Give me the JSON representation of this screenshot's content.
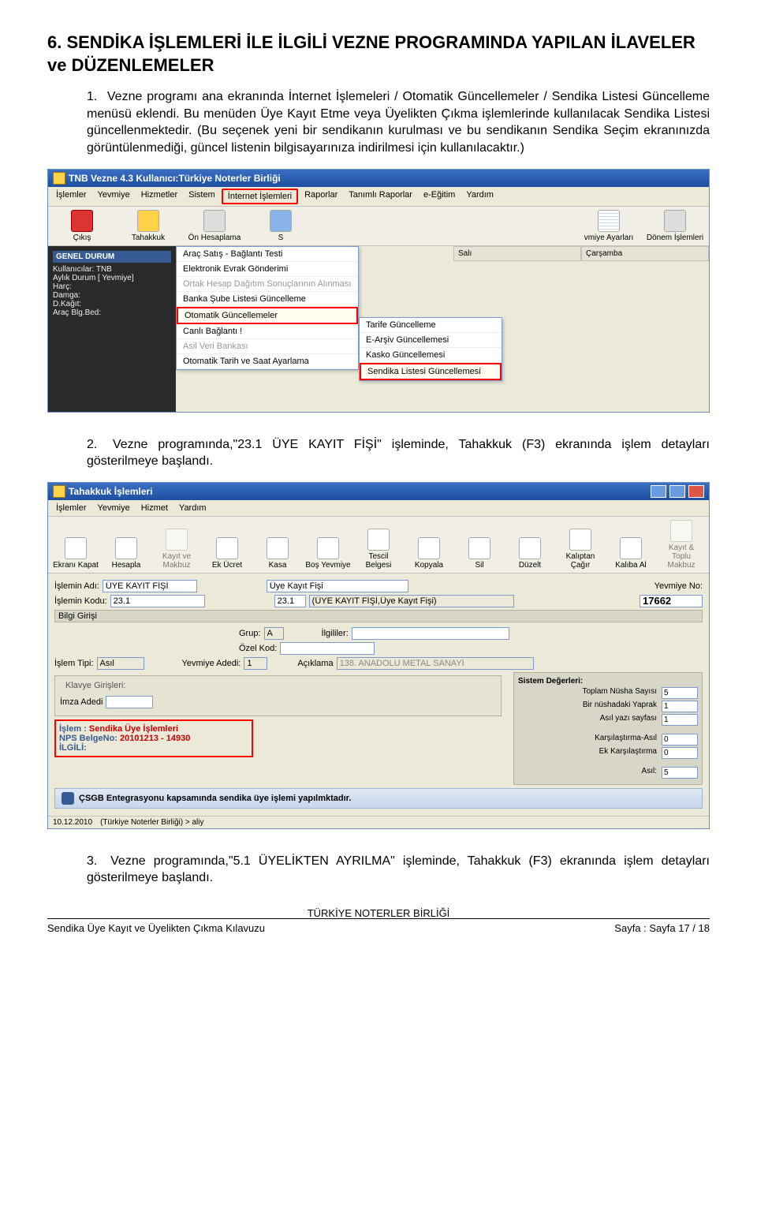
{
  "heading": "6. SENDİKA İŞLEMLERİ İLE İLGİLİ VEZNE PROGRAMINDA YAPILAN  İLAVELER ve DÜZENLEMELER",
  "para1_idx": "1.",
  "para1": "Vezne programı ana ekranında İnternet İşlemeleri / Otomatik Güncellemeler / Sendika Listesi Güncelleme menüsü eklendi. Bu menüden  Üye Kayıt Etme veya Üyelikten Çıkma işlemlerinde kullanılacak Sendika Listesi güncellenmektedir. (Bu seçenek yeni bir sendikanın kurulması ve bu sendikanın Sendika Seçim ekranınızda görüntülenmediği, güncel listenin bilgisayarınıza indirilmesi için kullanılacaktır.)",
  "para2_idx": "2.",
  "para2": "Vezne programında,\"23.1 ÜYE KAYIT FİŞİ\" işleminde, Tahakkuk (F3) ekranında işlem detayları gösterilmeye başlandı.",
  "para3_idx": "3.",
  "para3": "Vezne programında,\"5.1 ÜYELİKTEN AYRILMA\" işleminde, Tahakkuk (F3) ekranında işlem detayları gösterilmeye başlandı.",
  "shot1": {
    "title": "TNB Vezne 4.3  Kullanıcı:Türkiye Noterler Birliği",
    "menu": [
      "İşlemler",
      "Yevmiye",
      "Hizmetler",
      "Sistem",
      "İnternet İşlemleri",
      "Raporlar",
      "Tanımlı Raporlar",
      "e-Eğitim",
      "Yardım"
    ],
    "menu_hl_index": 4,
    "toolbar": [
      {
        "lbl": "Çıkış",
        "cls": "red"
      },
      {
        "lbl": "Tahakkuk",
        "cls": "yell"
      },
      {
        "lbl": "Ön Hesaplama",
        "cls": "gray"
      },
      {
        "lbl": "S",
        "cls": "blue"
      },
      {
        "lbl": "vmiye Ayarları",
        "cls": "cal"
      },
      {
        "lbl": "Dönem İşlemleri",
        "cls": "gray"
      }
    ],
    "side_hdr": "GENEL DURUM",
    "side_lines": [
      "Kullanıcılar: TNB",
      "Aylık Durum [ Yevmiye]",
      "Harç:",
      "Damga:",
      "D.Kağıt:",
      "Araç Blg.Bed:"
    ],
    "dd": [
      {
        "t": "Araç Satış - Bağlantı Testi"
      },
      {
        "t": "Elektronik Evrak Gönderimi"
      },
      {
        "t": "Ortak Hesap Dağıtım Sonuçlarının Alınması",
        "dis": true
      },
      {
        "t": "Banka Şube Listesi Güncelleme"
      },
      {
        "t": "Otomatik Güncellemeler",
        "hl": true
      },
      {
        "t": "Canlı Bağlantı !"
      },
      {
        "t": "Asil Veri Bankası",
        "dis": true
      },
      {
        "t": "Otomatik Tarih ve Saat Ayarlama"
      }
    ],
    "sub": [
      {
        "t": "Tarife Güncelleme"
      },
      {
        "t": "E-Arşiv Güncellemesi"
      },
      {
        "t": "Kasko Güncellemesi"
      },
      {
        "t": "Sendika Listesi Güncellemesi",
        "hl": true
      }
    ],
    "days": [
      "Salı",
      "Çarşamba"
    ]
  },
  "shot2": {
    "title": "Tahakkuk İşlemleri",
    "menu": [
      "İşlemler",
      "Yevmiye",
      "Hizmet",
      "Yardım"
    ],
    "toolbar": [
      "Ekranı Kapat",
      "Hesapla",
      "Kayıt ve Makbuz",
      "Ek Ücret",
      "Kasa",
      "Boş Yevmiye",
      "Tescil Belgesi",
      "Kopyala",
      "Sil",
      "Düzelt",
      "Kalıptan Çağır",
      "Kalıba Al",
      "Kayıt & Toplu Makbuz"
    ],
    "islemin_adi_lbl": "İşlemin Adı:",
    "islemin_adi_val": "ÜYE KAYIT FİŞİ",
    "uye_kayit_fisi_lbl": "Üye Kayıt Fişi",
    "islemin_kodu_lbl": "İşlemin Kodu:",
    "islemin_kodu_val": "23.1",
    "kod2": "23.1",
    "kod2_desc": "(ÜYE KAYIT FİŞİ,Üye Kayıt Fişi)",
    "yevno_lbl": "Yevmiye No:",
    "yevno_val": "17662",
    "bilgi_hdr": "Bilgi Girişi",
    "grup_lbl": "Grup:",
    "grup_val": "A",
    "ilgililer_lbl": "İlgililer:",
    "ozelkod_lbl": "Özel Kod:",
    "islem_tipi_lbl": "İşlem Tipi:",
    "islem_tipi_val": "Asıl",
    "yev_aded_lbl": "Yevmiye Adedi:",
    "yev_aded_val": "1",
    "aciklama_lbl": "Açıklama",
    "aciklama_val": "138. ANADOLU METAL SANAYİ",
    "klavye_lbl": "Klavye Girişleri:",
    "imza_lbl": "İmza Adedi",
    "sys_hdr": "Sistem Değerleri:",
    "sys": [
      {
        "l": "Toplam Nüsha Sayısı",
        "v": "5"
      },
      {
        "l": "Bir nüshadaki Yaprak",
        "v": "1"
      },
      {
        "l": "Asıl yazı sayfası",
        "v": "1"
      },
      {
        "l": "Karşılaştırma-Asıl",
        "v": "0"
      },
      {
        "l": "Ek Karşılaştırma",
        "v": "0"
      },
      {
        "l": "Asıl:",
        "v": "5"
      }
    ],
    "box_islem_lbl": "İşlem    :",
    "box_islem_val": "Sendika Üye İşlemleri",
    "box_nps_lbl": "NPS BelgeNo:",
    "box_nps_val": "20101213 - 14930",
    "box_ilgili": "İLGİLİ:",
    "infobar": "ÇSGB Entegrasyonu kapsamında sendika üye işlemi yapılmktadır.",
    "status_date": "10.12.2010",
    "status_user": "(Türkiye Noterler Birliği) > aliy"
  },
  "footer_center": "TÜRKİYE NOTERLER BİRLİĞİ",
  "footer_left": "Sendika Üye Kayıt ve Üyelikten Çıkma Kılavuzu",
  "footer_right": "Sayfa : Sayfa 17 / 18"
}
